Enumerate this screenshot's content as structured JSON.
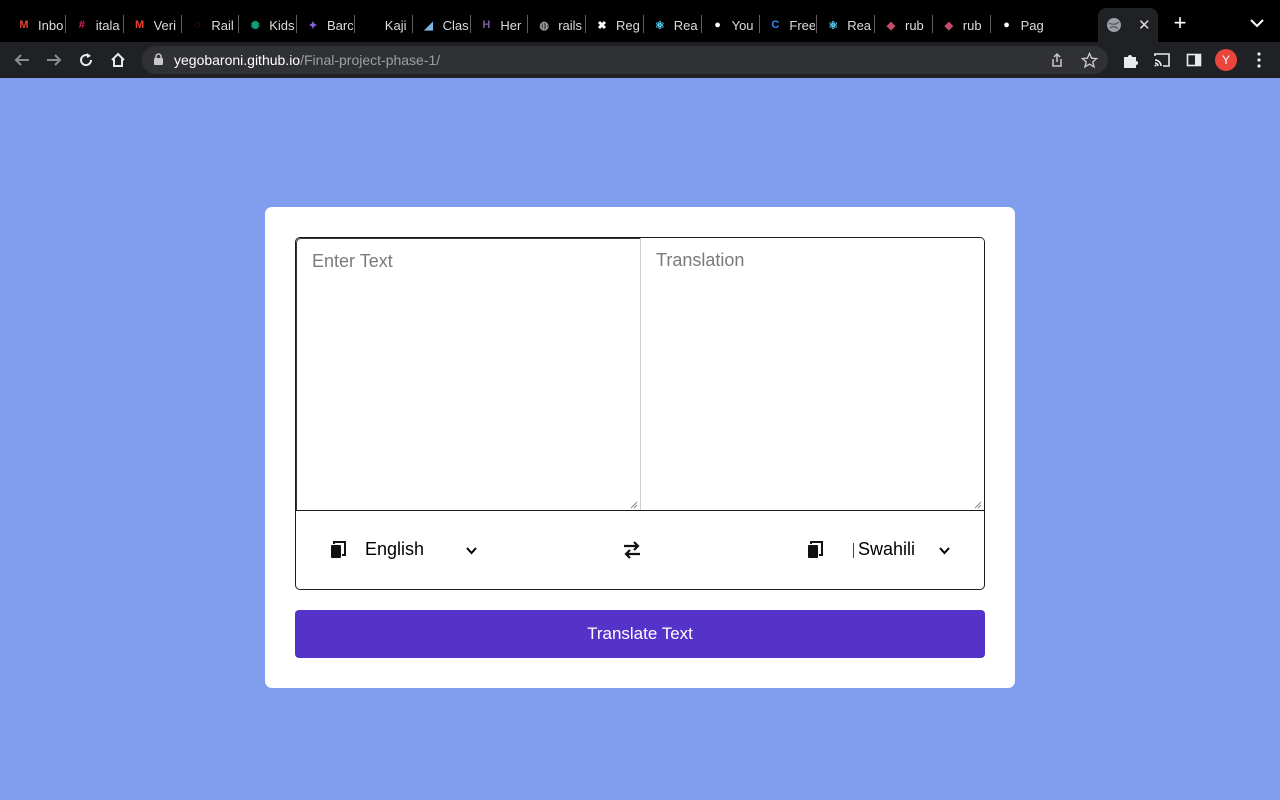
{
  "browser": {
    "tabs": [
      {
        "label": "Inbo",
        "icon": "gmail-icon",
        "color": "#ea4335",
        "glyph": "M"
      },
      {
        "label": "itala",
        "icon": "slack-icon",
        "color": "#e01e5a",
        "glyph": "#"
      },
      {
        "label": "Veri",
        "icon": "gmail-icon",
        "color": "#ea4335",
        "glyph": "M"
      },
      {
        "label": "Rail",
        "icon": "rails-icon",
        "color": "#cc0000",
        "glyph": "◌"
      },
      {
        "label": "Kids",
        "icon": "openai-icon",
        "color": "#10a37f",
        "glyph": "✺"
      },
      {
        "label": "Barc",
        "icon": "bard-icon",
        "color": "#8e63e8",
        "glyph": "✦"
      },
      {
        "label": "Kaji",
        "icon": "blank-icon",
        "color": "#000000",
        "glyph": ""
      },
      {
        "label": "Clas",
        "icon": "classroom-icon",
        "color": "#7cb3e0",
        "glyph": "◢"
      },
      {
        "label": "Her",
        "icon": "heroku-icon",
        "color": "#79589f",
        "glyph": "H"
      },
      {
        "label": "rails",
        "icon": "globe-icon",
        "color": "#9aa0a6",
        "glyph": "◍"
      },
      {
        "label": "Reg",
        "icon": "regex-icon",
        "color": "#ffffff",
        "glyph": "✖"
      },
      {
        "label": "Rea",
        "icon": "react-icon",
        "color": "#61dafb",
        "glyph": "⚛"
      },
      {
        "label": "You",
        "icon": "github-icon",
        "color": "#ffffff",
        "glyph": "●"
      },
      {
        "label": "Free",
        "icon": "freecodecamp-icon",
        "color": "#2b8cff",
        "glyph": "C"
      },
      {
        "label": "Rea",
        "icon": "react-icon",
        "color": "#61dafb",
        "glyph": "⚛"
      },
      {
        "label": "rub",
        "icon": "ruby-icon",
        "color": "#c34b6a",
        "glyph": "◆"
      },
      {
        "label": "rub",
        "icon": "ruby-icon",
        "color": "#c34b6a",
        "glyph": "◆"
      },
      {
        "label": "Pag",
        "icon": "github-icon",
        "color": "#ffffff",
        "glyph": "●"
      }
    ],
    "active_tab": {
      "icon": "globe-icon",
      "close": "✕"
    },
    "new_tab": "+",
    "url_host": "yegobaroni.github.io",
    "url_path": "/Final-project-phase-1/",
    "profile_initial": "Y",
    "colors": {
      "tabbar": "#000000",
      "toolbar": "#202124",
      "omnibox": "#303134",
      "avatar": "#e8453c"
    }
  },
  "translator": {
    "from_placeholder": "Enter Text",
    "to_placeholder": "Translation",
    "from_language": "English",
    "to_language": "Swahili",
    "button_label": "Translate Text",
    "colors": {
      "page_bg": "#7f9ced",
      "button": "#5533c9"
    }
  }
}
